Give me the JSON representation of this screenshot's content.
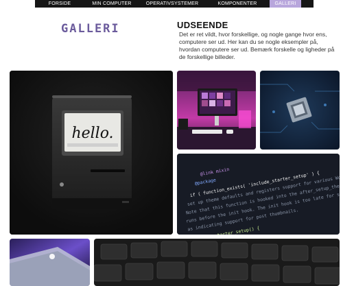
{
  "nav": {
    "items": [
      {
        "label": "FORSIDE",
        "active": false
      },
      {
        "label": "MIN COMPUTER",
        "active": false
      },
      {
        "label": "OPERATIVSYSTEMER",
        "active": false
      },
      {
        "label": "KOMPONENTER",
        "active": false
      },
      {
        "label": "GALLERI",
        "active": true
      }
    ]
  },
  "page": {
    "title": "GALLERI",
    "heading": "UDSEENDE",
    "intro": "Det er ret vildt, hvor forskellige, og nogle gange hvor ens, computere ser ud. Her kan du se nogle eksempler på, hvordan computere ser ud. Bemærk forskelle og ligheder på de forskellige billeder."
  },
  "gallery": {
    "mac_screen_text": "hello.",
    "code_lines": [
      "@link mixin",
      "@package",
      "if ( function_exists( 'include_starter_setup' ) {",
      "set up theme defaults and registers support for various WordPress",
      "Note that this function is hooked into the after_setup_theme hook",
      "runs before the init hook. The init hook is too late for some",
      "as indicating support for post thumbnails.",
      "function starter_setup() {"
    ]
  },
  "colors": {
    "nav_bg": "#161616",
    "nav_active": "#b8a6dc",
    "title": "#6b5b9c"
  }
}
